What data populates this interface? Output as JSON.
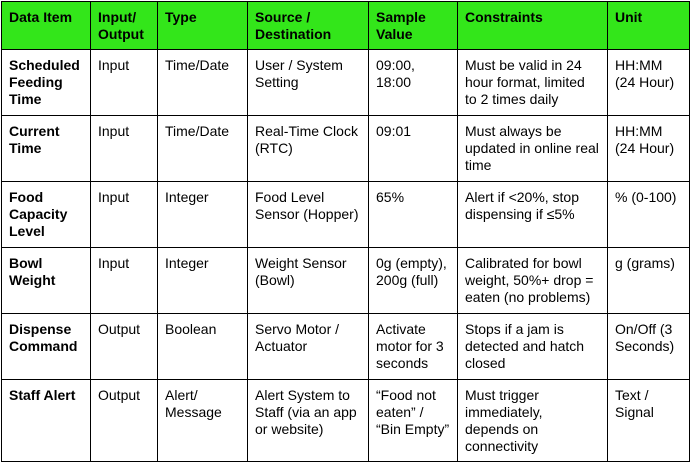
{
  "header_bg": "#33e61a",
  "columns": [
    "Data Item",
    "Input/ Output",
    "Type",
    "Source / Destination",
    "Sample Value",
    "Constraints",
    "Unit"
  ],
  "rows": [
    {
      "item": "Scheduled Feeding Time",
      "io": "Input",
      "type": "Time/Date",
      "source": "User / System Setting",
      "sample": "09:00, 18:00",
      "constraints": "Must be valid in 24 hour format, limited to 2 times daily",
      "unit": "HH:MM (24 Hour)"
    },
    {
      "item": "Current Time",
      "io": "Input",
      "type": "Time/Date",
      "source": "Real-Time Clock (RTC)",
      "sample": "09:01",
      "constraints": "Must always be updated in online real time",
      "unit": "HH:MM (24 Hour)"
    },
    {
      "item": "Food Capacity Level",
      "io": "Input",
      "type": "Integer",
      "source": "Food Level Sensor (Hopper)",
      "sample": "65%",
      "constraints": "Alert if <20%, stop dispensing if ≤5%",
      "unit": "% (0-100)"
    },
    {
      "item": "Bowl Weight",
      "io": "Input",
      "type": "Integer",
      "source": "Weight Sensor (Bowl)",
      "sample": "0g (empty), 200g (full)",
      "constraints": "Calibrated for bowl weight, 50%+ drop = eaten (no problems)",
      "unit": "g (grams)"
    },
    {
      "item": "Dispense Command",
      "io": "Output",
      "type": "Boolean",
      "source": "Servo Motor / Actuator",
      "sample": "Activate motor for 3 seconds",
      "constraints": "Stops if a jam is detected and hatch closed",
      "unit": "On/Off (3 Seconds)"
    },
    {
      "item": "Staff Alert",
      "io": "Output",
      "type": "Alert/ Message",
      "source": "Alert System to Staff (via an app or website)",
      "sample": "“Food not eaten” / “Bin Empty”",
      "constraints": "Must trigger immediately, depends on connectivity",
      "unit": "Text / Signal"
    }
  ]
}
